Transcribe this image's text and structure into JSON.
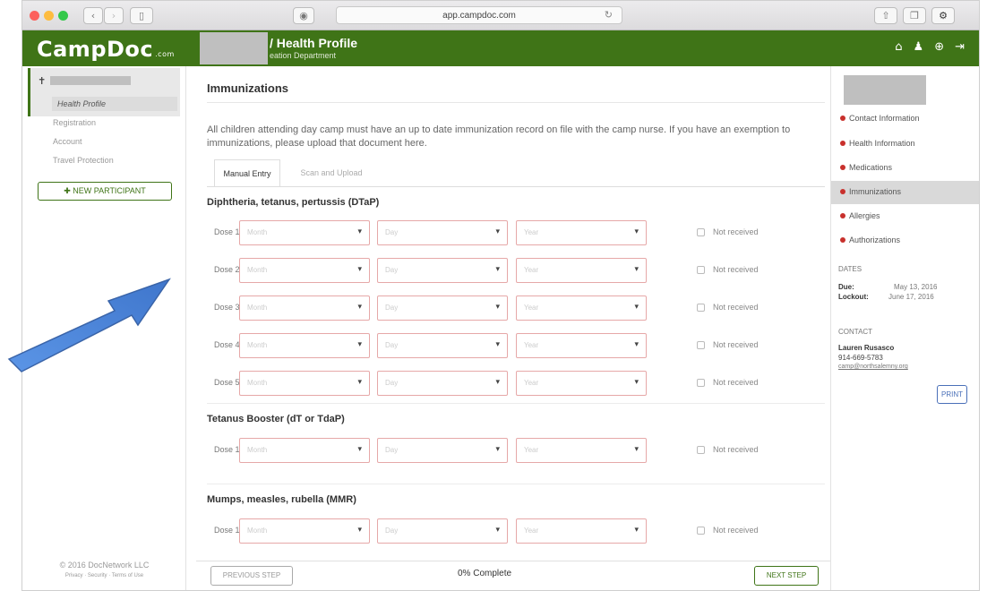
{
  "browser": {
    "url": "app.campdoc.com"
  },
  "header": {
    "logo": "CampDoc",
    "logo_suffix": ".com",
    "title": "/ Health Profile",
    "subtitle": "eation Department"
  },
  "left_nav": {
    "items": [
      "Health Profile",
      "Registration",
      "Account",
      "Travel Protection"
    ],
    "new_participant_label": "NEW PARTICIPANT",
    "copyright": "© 2016 DocNetwork LLC",
    "footer_links": "Privacy · Security · Terms of Use"
  },
  "main": {
    "title": "Immunizations",
    "description": "All children attending day camp must have an up to date immunization record on file with the camp nurse. If you have an exemption to immunizations, please upload that document here.",
    "tabs": [
      "Manual Entry",
      "Scan and Upload"
    ],
    "placeholders": {
      "month": "Month",
      "day": "Day",
      "year": "Year"
    },
    "not_received": "Not received",
    "sections": [
      {
        "title": "Diphtheria, tetanus, pertussis (DTaP)",
        "doses": [
          "Dose 1",
          "Dose 2",
          "Dose 3",
          "Dose 4",
          "Dose 5"
        ]
      },
      {
        "title": "Tetanus Booster (dT or TdaP)",
        "doses": [
          "Dose 1"
        ]
      },
      {
        "title": "Mumps, measles, rubella (MMR)",
        "doses": [
          "Dose 1"
        ]
      }
    ]
  },
  "bottom": {
    "prev_label": "PREVIOUS STEP",
    "progress": "0% Complete",
    "next_label": "NEXT STEP"
  },
  "right_nav": {
    "items": [
      "Contact Information",
      "Health Information",
      "Medications",
      "Immunizations",
      "Allergies",
      "Authorizations"
    ],
    "active_item": "Immunizations",
    "dates_heading": "DATES",
    "due_label": "Due:",
    "due_value": "May 13, 2016",
    "lockout_label": "Lockout:",
    "lockout_value": "June 17, 2016",
    "contact_heading": "CONTACT",
    "contact_name": "Lauren Rusasco",
    "contact_phone": "914-669-5783",
    "contact_email": "camp@northsalemny.org",
    "print_label": "PRINT"
  },
  "colors": {
    "brand_green": "#3f7417",
    "status_red": "#c8302c",
    "annotation_arrow": "#4d86d8"
  },
  "icons": [
    "back-arrow-icon",
    "forward-arrow-icon",
    "sidebar-icon",
    "privacy-icon",
    "reload-icon",
    "share-icon",
    "tabs-icon",
    "home-icon",
    "user-icon",
    "help-icon",
    "logout-icon",
    "pin-icon",
    "plus-icon",
    "chevron-down-icon"
  ]
}
